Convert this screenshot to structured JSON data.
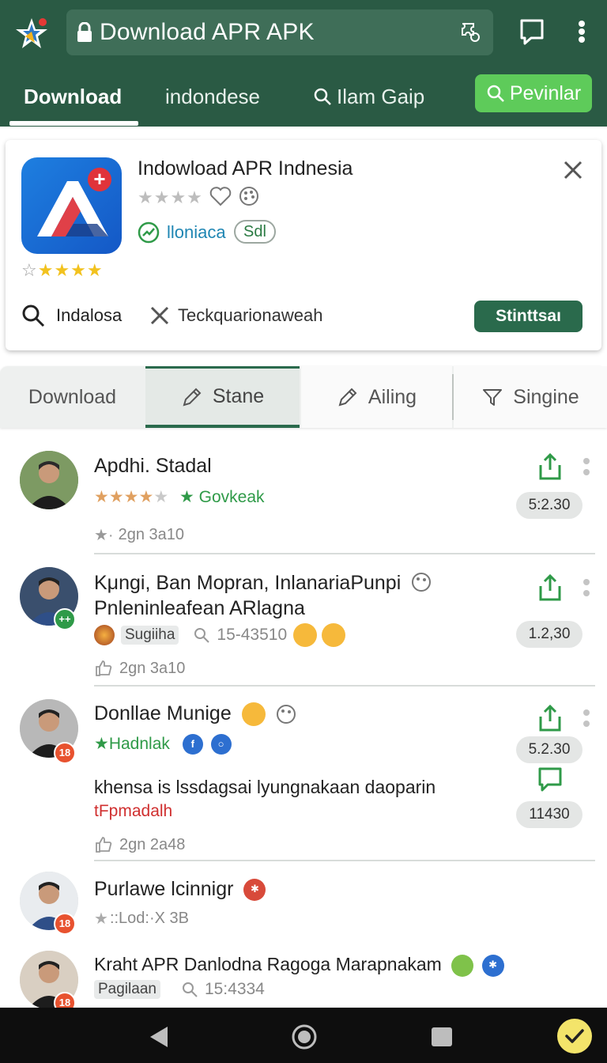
{
  "appbar": {
    "url_title": "Download APR APK",
    "tabs": [
      {
        "label": "Download"
      },
      {
        "label": "indondese"
      },
      {
        "label": "Ilam Gaip"
      }
    ],
    "action_button": "Pevinlar"
  },
  "card": {
    "title": "Indowload APR Indnesia",
    "category": "lloniaca",
    "badge": "Sdl",
    "search_label": "Indalosa",
    "x_label": "Teckquarionaweah",
    "action_button": "Stinttsaı"
  },
  "subtabs": [
    {
      "label": "Download"
    },
    {
      "label": "Stane"
    },
    {
      "label": "Ailing"
    },
    {
      "label": "Singine"
    }
  ],
  "list": [
    {
      "title": "Apdhi. Stadal",
      "sub": "Govkeak",
      "meta": "2gn 3a10",
      "pill": "5:2.30"
    },
    {
      "title": "Kμngi, Ban Mopran, InlanariaPunpi",
      "title2": "Pnleninleafean ARlagna",
      "chip": "Sugiiha",
      "count": "15-43510",
      "meta": "2gn 3a10",
      "pill": "1.2,30"
    },
    {
      "title": "Donllae Munige",
      "sub": "Hadnlak",
      "pill": "5.2.30",
      "body": "khensa is lssdagsai lyungnakaan daoparin",
      "body_red": "tFpmadalh",
      "pill2": "11430",
      "meta": "2gn 2a48"
    },
    {
      "title": "Purlawe lcinnigr",
      "meta": "::Lod:·X 3B"
    },
    {
      "title": "Kraht APR Danlodna Ragoga Marapnakam",
      "chip": "Pagilaan",
      "count": "15:4334"
    }
  ],
  "colors": {
    "appbar": "#2a5a44",
    "accent_green": "#5ecb5a",
    "primary_button": "#2a6a4c"
  }
}
